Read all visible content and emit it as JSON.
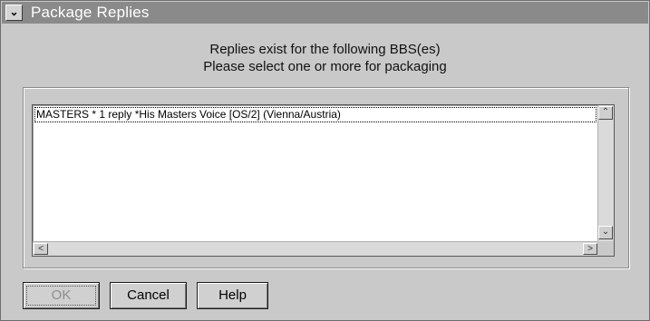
{
  "window": {
    "title": "Package Replies",
    "system_menu_glyph": "⌄"
  },
  "message": {
    "line1": "Replies exist for the following BBS(es)",
    "line2": "Please select one or more for packaging"
  },
  "list": {
    "items": [
      {
        "label": "MASTERS * 1 reply  *His Masters Voice [OS/2] (Vienna/Austria)"
      }
    ]
  },
  "scrollbars": {
    "up_glyph": "⌃",
    "down_glyph": "⌄",
    "left_glyph": "<",
    "right_glyph": ">"
  },
  "buttons": {
    "ok_label": "OK",
    "cancel_label": "Cancel",
    "help_label": "Help"
  }
}
